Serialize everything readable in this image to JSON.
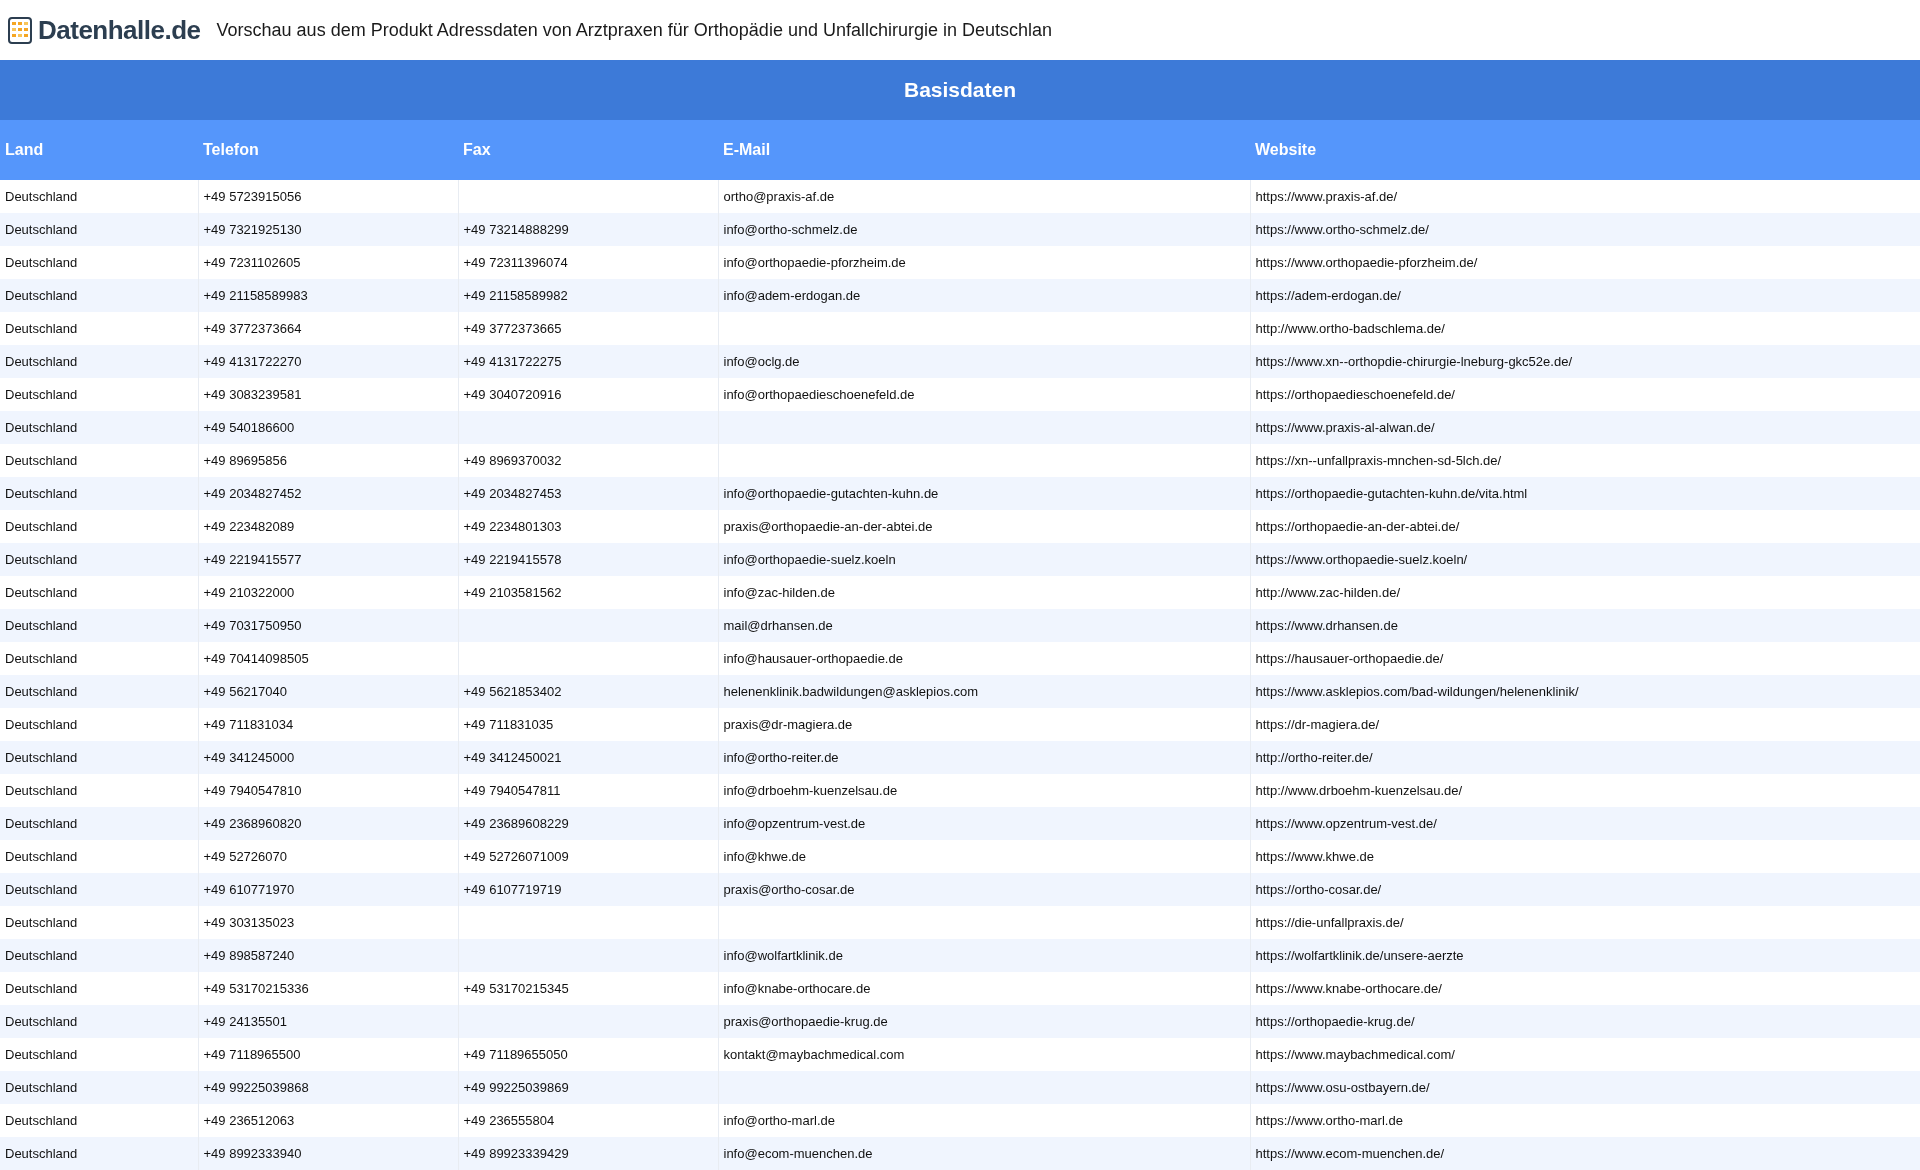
{
  "header": {
    "logo_text": "Datenhalle.de",
    "title": "Vorschau aus dem Produkt Adressdaten von Arztpraxen für Orthopädie und Unfallchirurgie in Deutschlan"
  },
  "table": {
    "group_title": "Basisdaten",
    "columns": [
      "Land",
      "Telefon",
      "Fax",
      "E-Mail",
      "Website"
    ],
    "rows": [
      [
        "Deutschland",
        "+49 5723915056",
        null,
        "ortho@praxis-af.de",
        "https://www.praxis-af.de/"
      ],
      [
        "Deutschland",
        "+49 7321925130",
        "+49 73214888299",
        "info@ortho-schmelz.de",
        "https://www.ortho-schmelz.de/"
      ],
      [
        "Deutschland",
        "+49 7231102605",
        "+49 72311396074",
        "info@orthopaedie-pforzheim.de",
        "https://www.orthopaedie-pforzheim.de/"
      ],
      [
        "Deutschland",
        "+49 21158589983",
        "+49 21158589982",
        "info@adem-erdogan.de",
        "https://adem-erdogan.de/"
      ],
      [
        "Deutschland",
        "+49 3772373664",
        "+49 3772373665",
        null,
        "http://www.ortho-badschlema.de/"
      ],
      [
        "Deutschland",
        "+49 4131722270",
        "+49 4131722275",
        "info@oclg.de",
        "https://www.xn--orthopdie-chirurgie-lneburg-gkc52e.de/"
      ],
      [
        "Deutschland",
        "+49 3083239581",
        "+49 3040720916",
        "info@orthopaedieschoenefeld.de",
        "https://orthopaedieschoenefeld.de/"
      ],
      [
        "Deutschland",
        "+49 540186600",
        null,
        null,
        "https://www.praxis-al-alwan.de/"
      ],
      [
        "Deutschland",
        "+49 89695856",
        "+49 8969370032",
        null,
        "https://xn--unfallpraxis-mnchen-sd-5lch.de/"
      ],
      [
        "Deutschland",
        "+49 2034827452",
        "+49 2034827453",
        "info@orthopaedie-gutachten-kuhn.de",
        "https://orthopaedie-gutachten-kuhn.de/vita.html"
      ],
      [
        "Deutschland",
        "+49 223482089",
        "+49 2234801303",
        "praxis@orthopaedie-an-der-abtei.de",
        "https://orthopaedie-an-der-abtei.de/"
      ],
      [
        "Deutschland",
        "+49 2219415577",
        "+49 2219415578",
        "info@orthopaedie-suelz.koeln",
        "https://www.orthopaedie-suelz.koeln/"
      ],
      [
        "Deutschland",
        "+49 210322000",
        "+49 2103581562",
        "info@zac-hilden.de",
        "http://www.zac-hilden.de/"
      ],
      [
        "Deutschland",
        "+49 7031750950",
        null,
        "mail@drhansen.de",
        "https://www.drhansen.de"
      ],
      [
        "Deutschland",
        "+49 70414098505",
        null,
        "info@hausauer-orthopaedie.de",
        "https://hausauer-orthopaedie.de/"
      ],
      [
        "Deutschland",
        "+49 56217040",
        "+49 5621853402",
        "helenenklinik.badwildungen@asklepios.com",
        "https://www.asklepios.com/bad-wildungen/helenenklinik/"
      ],
      [
        "Deutschland",
        "+49 711831034",
        "+49 711831035",
        "praxis@dr-magiera.de",
        "https://dr-magiera.de/"
      ],
      [
        "Deutschland",
        "+49 341245000",
        "+49 3412450021",
        "info@ortho-reiter.de",
        "http://ortho-reiter.de/"
      ],
      [
        "Deutschland",
        "+49 7940547810",
        "+49 7940547811",
        "info@drboehm-kuenzelsau.de",
        "http://www.drboehm-kuenzelsau.de/"
      ],
      [
        "Deutschland",
        "+49 2368960820",
        "+49 23689608229",
        "info@opzentrum-vest.de",
        "https://www.opzentrum-vest.de/"
      ],
      [
        "Deutschland",
        "+49 52726070",
        "+49 52726071009",
        "info@khwe.de",
        "https://www.khwe.de"
      ],
      [
        "Deutschland",
        "+49 610771970",
        "+49 6107719719",
        "praxis@ortho-cosar.de",
        "https://ortho-cosar.de/"
      ],
      [
        "Deutschland",
        "+49 303135023",
        null,
        null,
        "https://die-unfallpraxis.de/"
      ],
      [
        "Deutschland",
        "+49 898587240",
        null,
        "info@wolfartklinik.de",
        "https://wolfartklinik.de/unsere-aerzte"
      ],
      [
        "Deutschland",
        "+49 53170215336",
        "+49 53170215345",
        "info@knabe-orthocare.de",
        "https://www.knabe-orthocare.de/"
      ],
      [
        "Deutschland",
        "+49 24135501",
        null,
        "praxis@orthopaedie-krug.de",
        "https://orthopaedie-krug.de/"
      ],
      [
        "Deutschland",
        "+49 7118965500",
        "+49 71189655050",
        "kontakt@maybachmedical.com",
        "https://www.maybachmedical.com/"
      ],
      [
        "Deutschland",
        "+49 99225039868",
        "+49 99225039869",
        null,
        "https://www.osu-ostbayern.de/"
      ],
      [
        "Deutschland",
        "+49 236512063",
        "+49 236555804",
        "info@ortho-marl.de",
        "https://www.ortho-marl.de"
      ],
      [
        "Deutschland",
        "+49 8992333940",
        "+49 89923339429",
        "info@ecom-muenchen.de",
        "https://www.ecom-muenchen.de/"
      ]
    ]
  }
}
